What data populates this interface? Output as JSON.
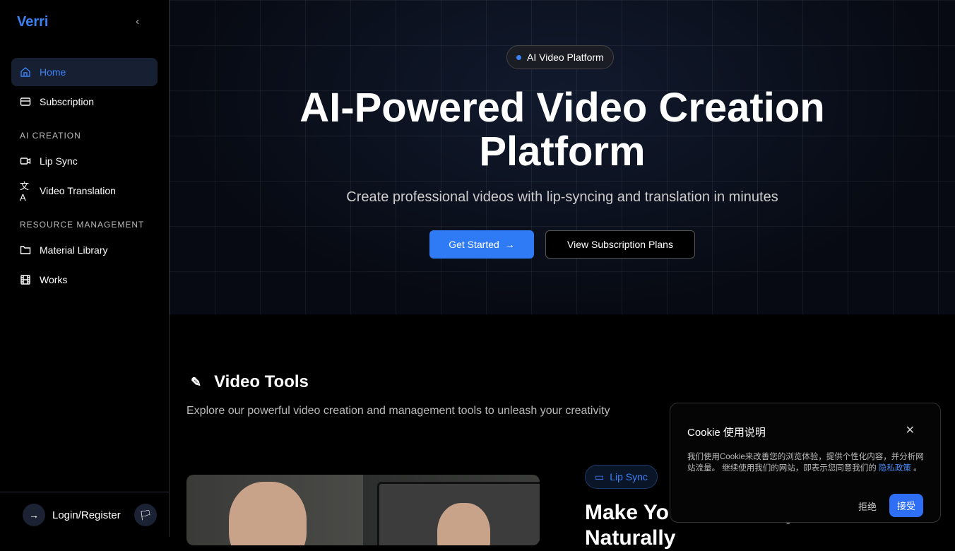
{
  "sidebar": {
    "logo": "Verri",
    "items": {
      "home": "Home",
      "subscription": "Subscription",
      "lip_sync": "Lip Sync",
      "video_translation": "Video Translation",
      "material_library": "Material Library",
      "works": "Works"
    },
    "sections": {
      "ai_creation": "AI CREATION",
      "resource": "RESOURCE MANAGEMENT"
    },
    "login": "Login/Register"
  },
  "hero": {
    "badge": "AI Video Platform",
    "title_line1": "AI-Powered Video Creation",
    "title_line2": "Platform",
    "subtitle": "Create professional videos with lip-syncing and translation in minutes",
    "get_started": "Get Started",
    "view_plans": "View Subscription Plans"
  },
  "tools": {
    "title": "Video Tools",
    "description": "Explore our powerful video creation and management tools to unleash your creativity",
    "lip_badge": "Lip Sync",
    "feature_title": "Make Your Videos Speak Naturally"
  },
  "cookie": {
    "title": "Cookie 使用说明",
    "text": "我们使用Cookie来改善您的浏览体验，提供个性化内容，并分析网站流量。 继续使用我们的网站，即表示您同意我们的 ",
    "link": "隐私政策",
    "end": " 。",
    "reject": "拒绝",
    "accept": "接受"
  },
  "colors": {
    "accent": "#3b82f6"
  }
}
